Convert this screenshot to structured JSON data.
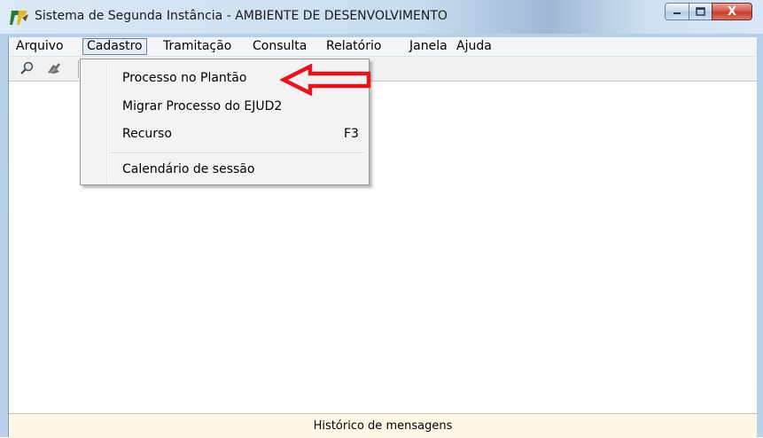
{
  "window": {
    "title": "Sistema de Segunda Instância - AMBIENTE DE DESENVOLVIMENTO",
    "app_icon": "app-logo-icon",
    "controls": {
      "minimize": "minimize-icon",
      "maximize": "maximize-icon",
      "close_label": "X"
    }
  },
  "menubar": {
    "items": [
      "Arquivo",
      "Cadastro",
      "Tramitação",
      "Consulta",
      "Relatório",
      "Janela",
      "Ajuda"
    ],
    "active": "Cadastro"
  },
  "toolbar": {
    "icons": [
      "search-tool-icon",
      "settings-tool-icon"
    ]
  },
  "dropdown": {
    "items": [
      {
        "label": "Processo no Plantão",
        "shortcut": ""
      },
      {
        "label": "Migrar Processo do EJUD2",
        "shortcut": ""
      },
      {
        "label": "Recurso",
        "shortcut": "F3"
      },
      {
        "label": "Calendário de sessão",
        "shortcut": ""
      }
    ]
  },
  "annotation": {
    "type": "red-arrow-pointing-left",
    "color": "#e8141b"
  },
  "statusbar": {
    "label": "Histórico de mensagens"
  },
  "colors": {
    "accent_red": "#e8141b",
    "status_bg": "#fff8e6"
  }
}
